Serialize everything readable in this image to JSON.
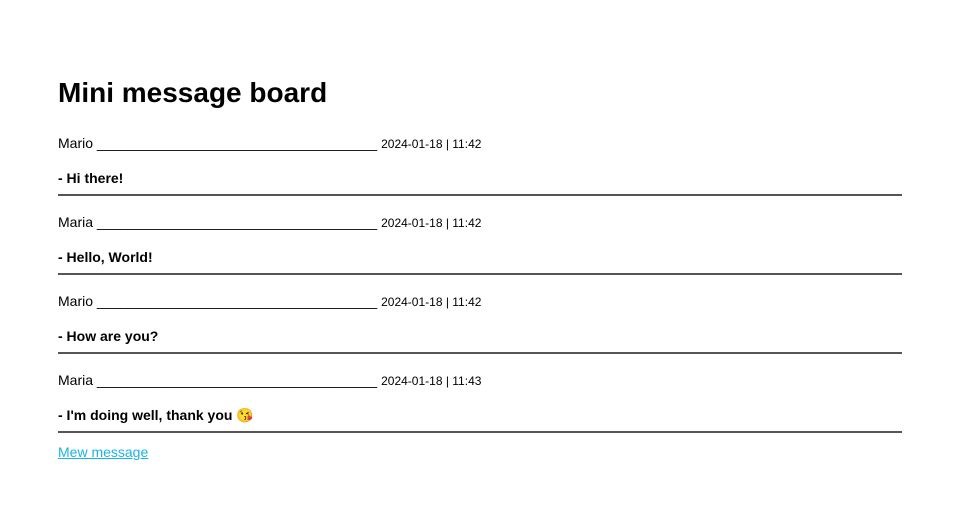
{
  "page": {
    "title": "Mini message board",
    "separator": "____________________________________"
  },
  "messages": [
    {
      "user": "Mario",
      "date": "2024-01-18 | 11:42",
      "text": "- Hi there!"
    },
    {
      "user": "Maria",
      "date": "2024-01-18 | 11:42",
      "text": "- Hello, World!"
    },
    {
      "user": "Mario",
      "date": "2024-01-18 | 11:42",
      "text": "- How are you?"
    },
    {
      "user": "Maria",
      "date": "2024-01-18 | 11:43",
      "text": "- I'm doing well, thank you 😘"
    }
  ],
  "new_message_link": "Mew message",
  "colors": {
    "link": "#1ab3e6",
    "rule": "#555555"
  }
}
